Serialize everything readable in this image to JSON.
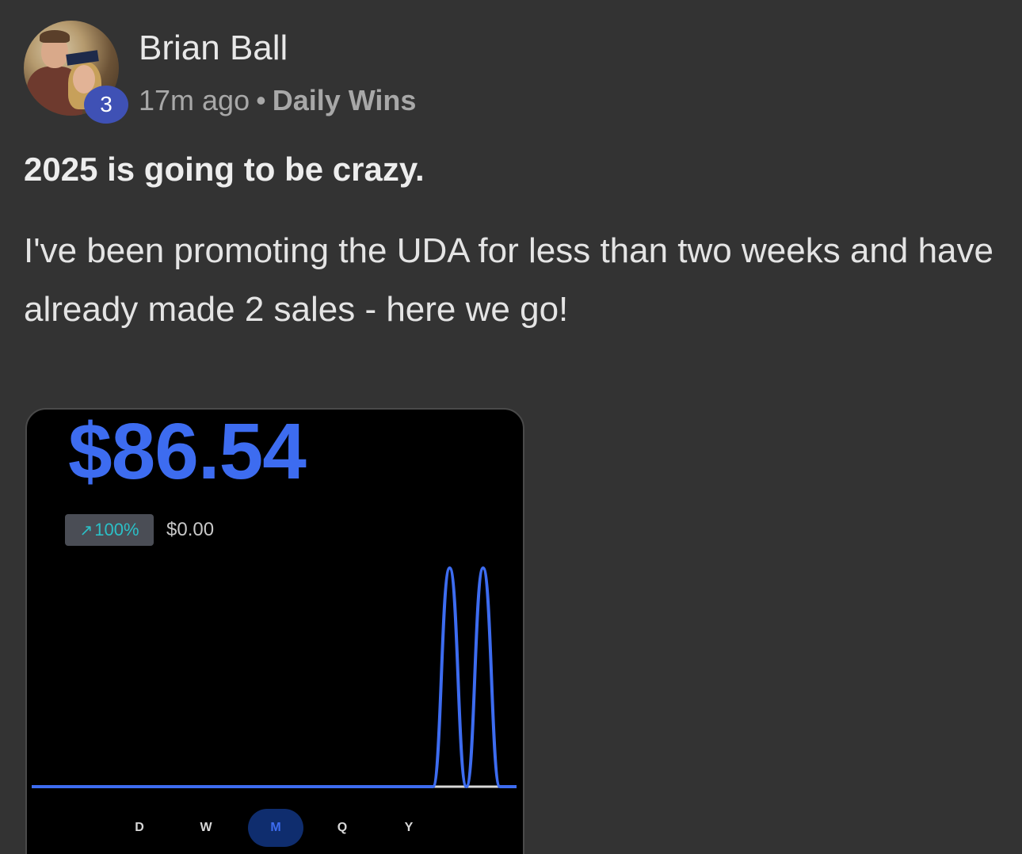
{
  "post": {
    "author_name": "Brian Ball",
    "level_badge": "3",
    "time_ago": "17m ago",
    "separator": "•",
    "category": "Daily Wins",
    "title": "2025 is going to be crazy.",
    "body": "I've been promoting the UDA for less than two weeks and have already made 2 sales - here we go!"
  },
  "attachment": {
    "total_amount": "$86.54",
    "change_percent": "100%",
    "change_icon": "arrow-up-right-icon",
    "previous_amount": "$0.00",
    "range_tabs": [
      "D",
      "W",
      "M",
      "Q",
      "Y"
    ],
    "active_range": "M",
    "colors": {
      "accent": "#3d6cf0",
      "positive": "#2bc0c7",
      "background": "#000000"
    },
    "chart_data": {
      "type": "line",
      "x": [
        1,
        2,
        3,
        4,
        5,
        6,
        7,
        8,
        9,
        10,
        11,
        12,
        13,
        14,
        15,
        16,
        17,
        18,
        19,
        20,
        21,
        22,
        23,
        24,
        25,
        26,
        27,
        28,
        29,
        30
      ],
      "series": [
        {
          "values": [
            0,
            0,
            0,
            0,
            0,
            0,
            0,
            0,
            0,
            0,
            0,
            0,
            0,
            0,
            0,
            0,
            0,
            0,
            0,
            0,
            0,
            0,
            0,
            0,
            0,
            43.27,
            0,
            43.27,
            0,
            0
          ]
        }
      ],
      "title": "",
      "xlabel": "",
      "ylabel": "",
      "grid": false
    }
  }
}
